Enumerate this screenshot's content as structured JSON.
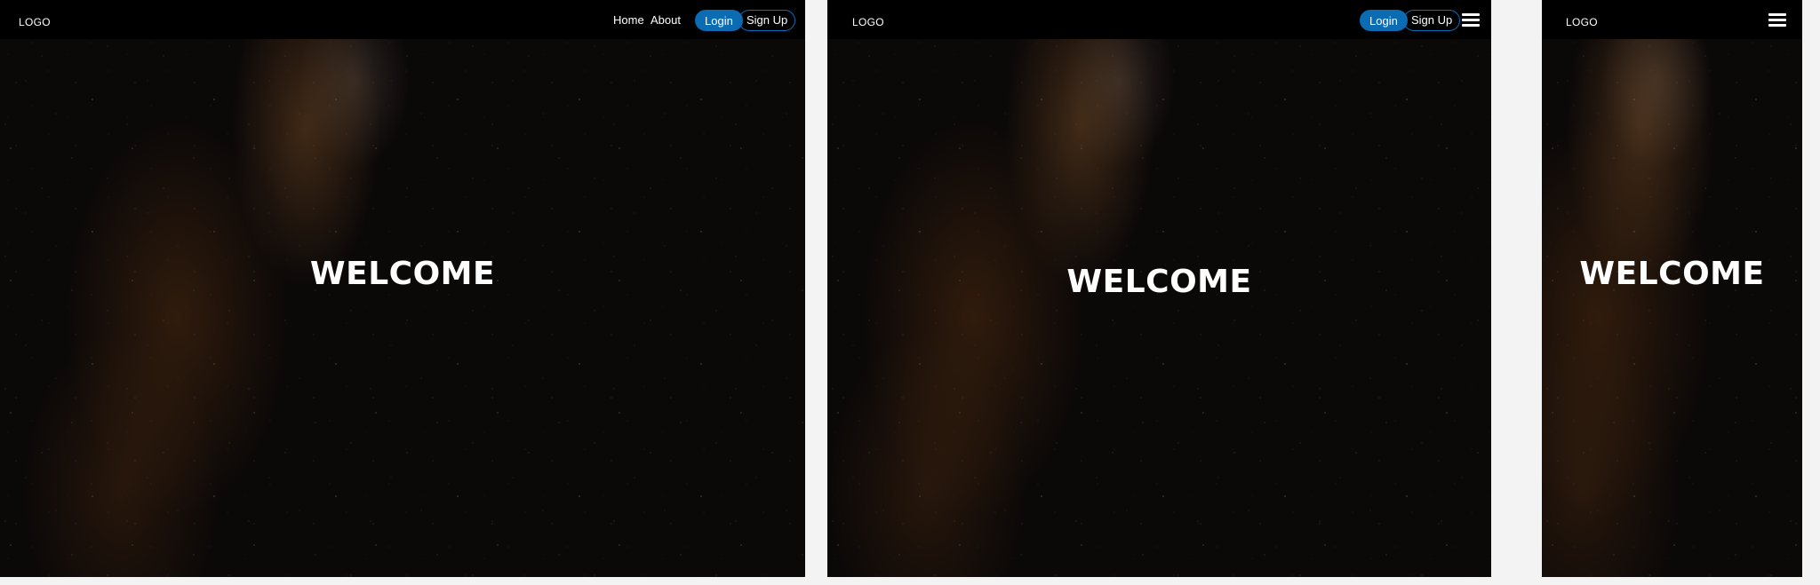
{
  "desktop": {
    "logo": "LOGO",
    "nav": {
      "home": "Home",
      "about": "About"
    },
    "login_label": "Login",
    "signup_label": "Sign Up",
    "hero_title": "WELCOME"
  },
  "tablet": {
    "logo": "LOGO",
    "login_label": "Login",
    "signup_label": "Sign Up",
    "menu_icon": "hamburger-menu-icon",
    "hero_title": "WELCOME"
  },
  "mobile": {
    "logo": "LOGO",
    "menu_icon": "hamburger-menu-icon",
    "hero_title": "WELCOME"
  },
  "colors": {
    "navbar_bg": "#000000",
    "accent": "#0b6bb3",
    "page_bg": "#f3f3f3",
    "hero_bg": "#0b0808"
  }
}
